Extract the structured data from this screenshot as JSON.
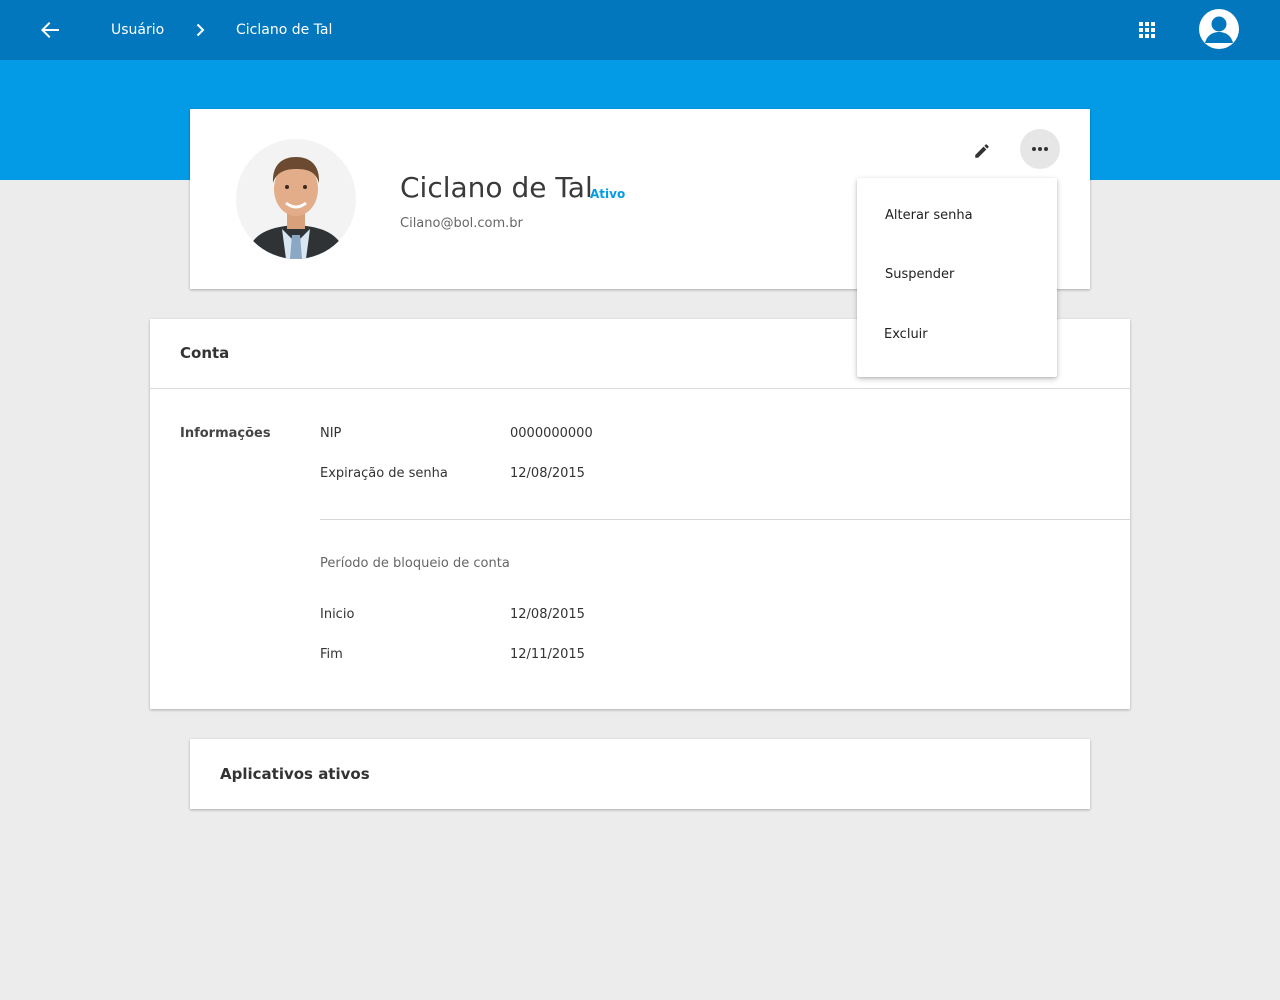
{
  "header": {
    "back_icon": "arrow-left-icon",
    "breadcrumb": [
      "Usuário",
      "Ciclano de Tal"
    ],
    "separator_icon": "chevron-right-icon",
    "apps_icon": "apps-grid-icon",
    "account_icon": "account-circle-icon"
  },
  "profile": {
    "name": "Ciclano de Tal",
    "status": "Ativo",
    "email": "Cilano@bol.com.br",
    "edit_icon": "pencil-icon",
    "more_icon": "more-horizontal-icon"
  },
  "menu": {
    "items": [
      "Alterar senha",
      "Suspender",
      "Excluir"
    ]
  },
  "account": {
    "title": "Conta",
    "section_label": "Informações",
    "info": [
      {
        "label": "NIP",
        "value": "0000000000"
      },
      {
        "label": "Expiração de senha",
        "value": "12/08/2015"
      }
    ],
    "block_period_title": "Período de bloqueio de conta",
    "block": [
      {
        "label": "Inicio",
        "value": "12/08/2015"
      },
      {
        "label": "Fim",
        "value": "12/11/2015"
      }
    ]
  },
  "apps": {
    "title": "Aplicativos ativos"
  },
  "colors": {
    "appbar": "#0277bd",
    "hero": "#039be5",
    "status_accent": "#039be5",
    "background": "#ececec"
  }
}
